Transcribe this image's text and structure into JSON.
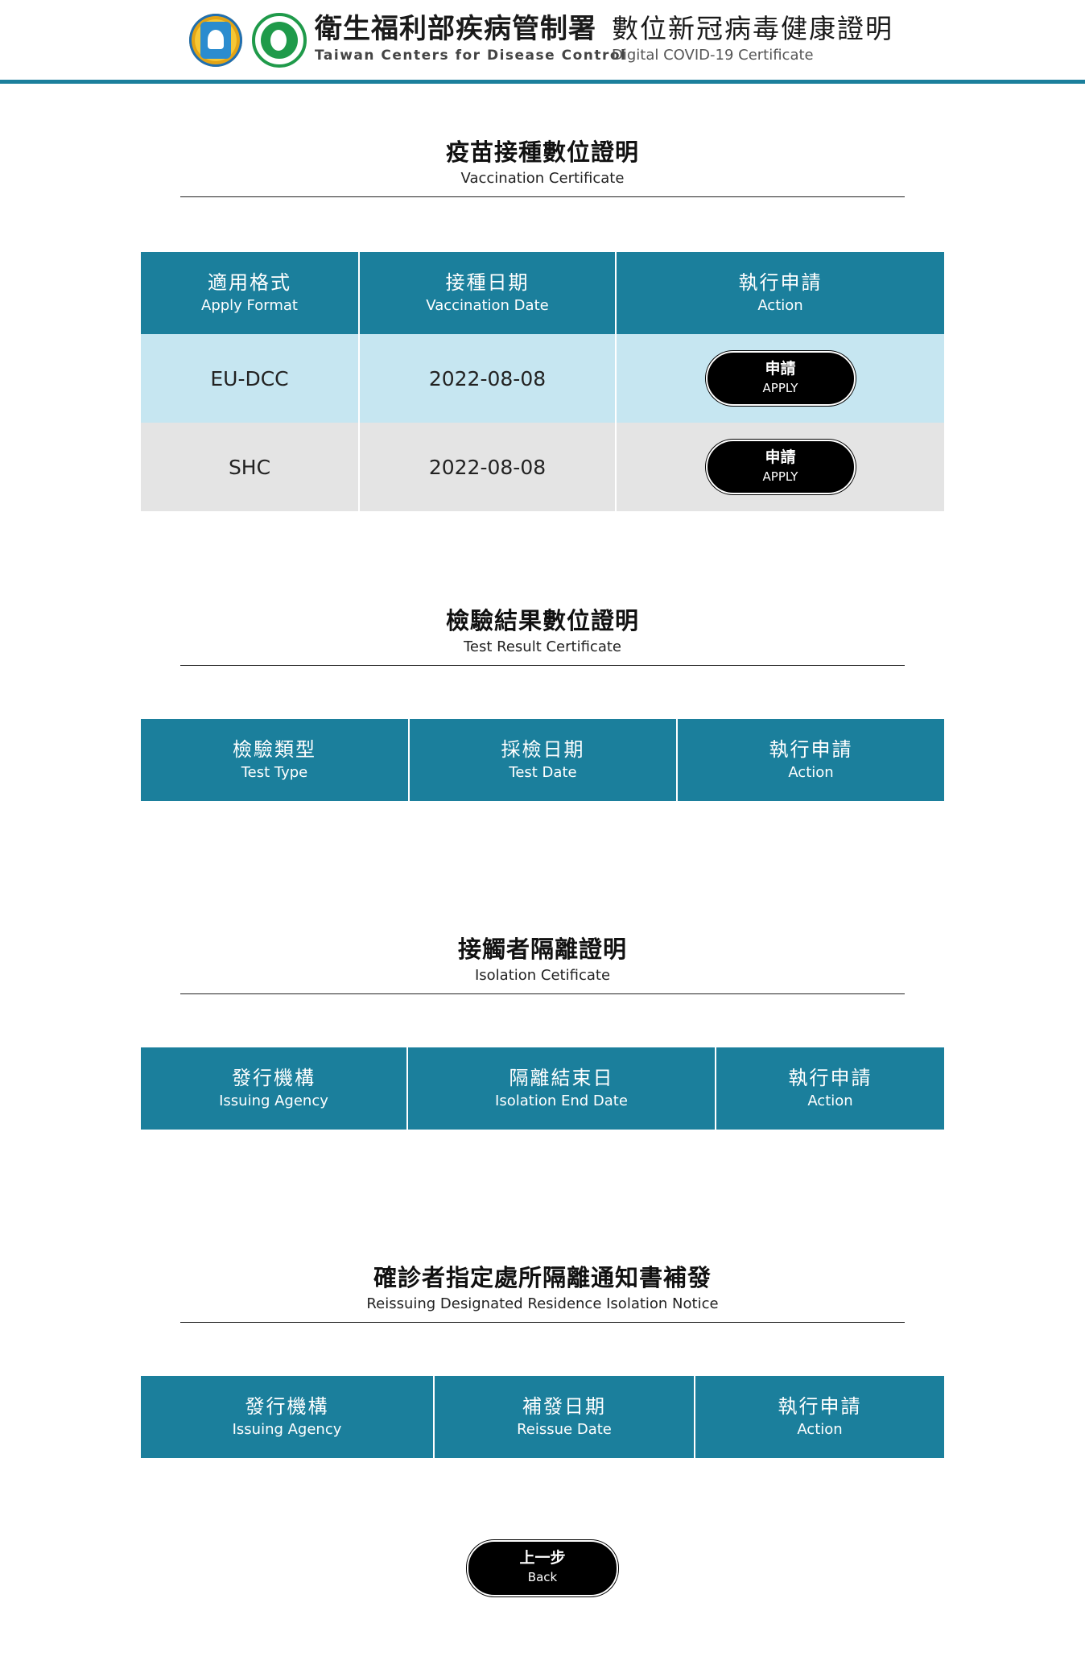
{
  "header": {
    "agency_zh": "衛生福利部疾病管制署",
    "agency_en": "Taiwan Centers for Disease Control",
    "cert_zh": "數位新冠病毒健康證明",
    "cert_en": "Digital COVID-19 Certificate"
  },
  "vaccination": {
    "title_zh": "疫苗接種數位證明",
    "title_en": "Vaccination Certificate",
    "columns": [
      {
        "zh": "適用格式",
        "en": "Apply Format"
      },
      {
        "zh": "接種日期",
        "en": "Vaccination Date"
      },
      {
        "zh": "執行申請",
        "en": "Action"
      }
    ],
    "rows": [
      {
        "format": "EU-DCC",
        "date": "2022-08-08",
        "button_zh": "申請",
        "button_en": "APPLY"
      },
      {
        "format": "SHC",
        "date": "2022-08-08",
        "button_zh": "申請",
        "button_en": "APPLY"
      }
    ]
  },
  "test": {
    "title_zh": "檢驗結果數位證明",
    "title_en": "Test Result Certificate",
    "columns": [
      {
        "zh": "檢驗類型",
        "en": "Test Type"
      },
      {
        "zh": "採檢日期",
        "en": "Test Date"
      },
      {
        "zh": "執行申請",
        "en": "Action"
      }
    ]
  },
  "isolation": {
    "title_zh": "接觸者隔離證明",
    "title_en": "Isolation Cetificate",
    "columns": [
      {
        "zh": "發行機構",
        "en": "Issuing Agency"
      },
      {
        "zh": "隔離結束日",
        "en": "Isolation End Date"
      },
      {
        "zh": "執行申請",
        "en": "Action"
      }
    ]
  },
  "reissue": {
    "title_zh": "確診者指定處所隔離通知書補發",
    "title_en": "Reissuing Designated Residence Isolation Notice",
    "columns": [
      {
        "zh": "發行機構",
        "en": "Issuing Agency"
      },
      {
        "zh": "補發日期",
        "en": "Reissue Date"
      },
      {
        "zh": "執行申請",
        "en": "Action"
      }
    ]
  },
  "back": {
    "zh": "上一步",
    "en": "Back"
  }
}
